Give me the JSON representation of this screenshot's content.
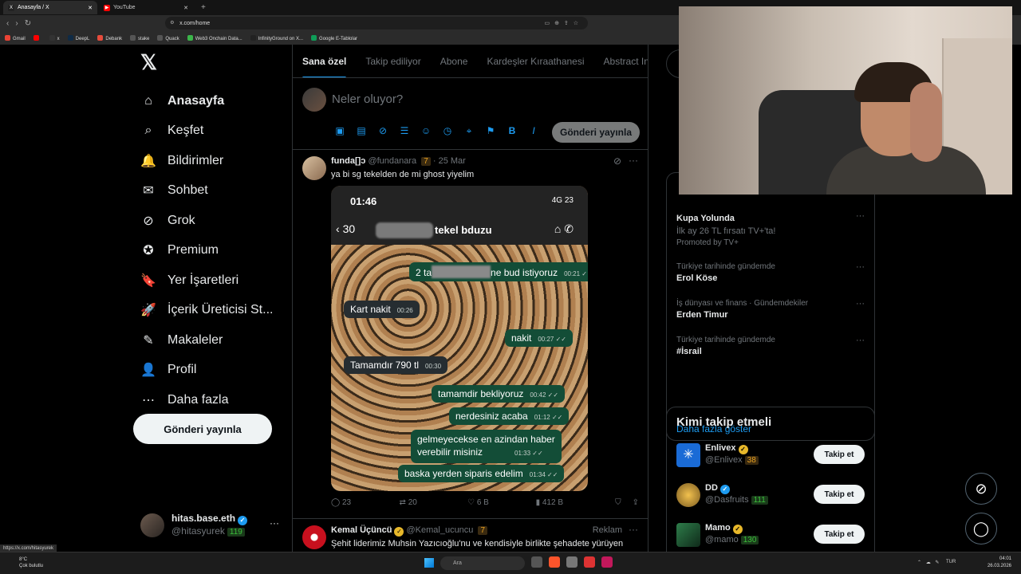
{
  "browser": {
    "tabs": [
      {
        "label": "Anasayfa / X",
        "close": "✕"
      },
      {
        "label": "YouTube",
        "close": "✕"
      }
    ],
    "new_tab": "+",
    "url": "x.com/home",
    "bookmarks": [
      "Gmail",
      "x",
      "DeepL",
      "Debank",
      "stake",
      "Quack",
      "Web3 Onchain Data...",
      "InfinityGround on X...",
      "Google E-Tablolar"
    ],
    "status_url": "https://x.com/hitasyurek"
  },
  "sidebar": {
    "logo": "𝕏",
    "items": [
      {
        "label": "Anasayfa",
        "icon": "home-icon",
        "glyph": "⌂"
      },
      {
        "label": "Keşfet",
        "icon": "search-icon",
        "glyph": "⌕"
      },
      {
        "label": "Bildirimler",
        "icon": "bell-icon",
        "glyph": "🔔"
      },
      {
        "label": "Sohbet",
        "icon": "mail-icon",
        "glyph": "✉"
      },
      {
        "label": "Grok",
        "icon": "grok-icon",
        "glyph": "⊘"
      },
      {
        "label": "Premium",
        "icon": "premium-icon",
        "glyph": "✪"
      },
      {
        "label": "Yer İşaretleri",
        "icon": "bookmark-icon",
        "glyph": "🔖"
      },
      {
        "label": "İçerik Üreticisi St...",
        "icon": "rocket-icon",
        "glyph": "🚀"
      },
      {
        "label": "Makaleler",
        "icon": "article-icon",
        "glyph": "✎"
      },
      {
        "label": "Profil",
        "icon": "profile-icon",
        "glyph": "👤"
      },
      {
        "label": "Daha fazla",
        "icon": "more-icon",
        "glyph": "⋯"
      }
    ],
    "post_button": "Gönderi yayınla",
    "account": {
      "name": "hitas.base.eth",
      "handle": "@hitasyurek",
      "badge": "119",
      "more": "···"
    }
  },
  "feed": {
    "tabs": [
      "Sana özel",
      "Takip ediliyor",
      "Abone",
      "Kardeşler Kıraathanesi",
      "Abstract Int"
    ],
    "composer": {
      "placeholder": "Neler oluyor?",
      "post_button": "Gönderi yayınla"
    },
    "post1": {
      "name": "funda[]ɔ",
      "handle": "@fundanara",
      "badge": "7",
      "date": "· 25 Mar",
      "text": "ya bi sg tekelden de mi ghost yiyelim",
      "screenshot": {
        "time": "01:46",
        "signal": "4G 23",
        "back_count": "30",
        "contact": "tekel bduzu",
        "messages": [
          {
            "dir": "out",
            "text_a": "2 ta",
            "text_b": "ne bud istiyoruz",
            "time": "00:21 ✓✓"
          },
          {
            "dir": "in",
            "text": "Kart nakit",
            "time": "00:26"
          },
          {
            "dir": "out",
            "text": "nakit",
            "time": "00:27 ✓✓"
          },
          {
            "dir": "in",
            "text": "Tamamdır 790 tl",
            "time": "00:30"
          },
          {
            "dir": "out",
            "text": "tamamdir bekliyoruz",
            "time": "00:42 ✓✓"
          },
          {
            "dir": "out",
            "text": "nerdesiniz acaba",
            "time": "01:12 ✓✓"
          },
          {
            "dir": "out",
            "text": "gelmeyecekse en azindan haber",
            "time": ""
          },
          {
            "dir": "out",
            "text": "verebilir misiniz",
            "time": "01:33 ✓✓"
          },
          {
            "dir": "out",
            "text": "baska yerden siparis edelim",
            "time": "01:34 ✓✓"
          }
        ]
      },
      "stats": {
        "replies": "23",
        "reposts": "20",
        "likes": "6 B",
        "views": "412 B"
      }
    },
    "post2": {
      "name": "Kemal Üçüncü",
      "handle": "@Kemal_ucuncu",
      "badge": "7",
      "tag": "Reklam",
      "text": "Şehit liderimiz Muhsin Yazıcıoğlu'nu ve kendisiyle birlikte şehadete yürüyen"
    }
  },
  "right": {
    "trends": [
      {
        "cat": "",
        "title": "Kupa Yolunda",
        "sub": "İlk ay 26 TL fırsatı TV+'ta!",
        "sub2": "Promoted by TV+"
      },
      {
        "cat": "Türkiye tarihinde gündemde",
        "title": "Erol Köse"
      },
      {
        "cat": "İş dünyası ve finans · Gündemdekiler",
        "title": "Erden Timur"
      },
      {
        "cat": "Türkiye tarihinde gündemde",
        "title": "#İsrail"
      }
    ],
    "show_more": "Daha fazla göster",
    "who_to_follow": {
      "title": "Kimi takip etmeli",
      "items": [
        {
          "name": "Enlivex",
          "handle": "@Enlivex",
          "badge": "38",
          "button": "Takip et"
        },
        {
          "name": "DD",
          "handle": "@Dasfruits",
          "badge": "111",
          "button": "Takip et"
        },
        {
          "name": "Mamo",
          "handle": "@mamo",
          "badge": "130",
          "button": "Takip et"
        }
      ]
    }
  },
  "taskbar": {
    "weather_temp": "8°C",
    "weather_desc": "Çok bulutlu",
    "search": "Ara",
    "lang": "TUR",
    "time": "04:01",
    "date": "26.03.2026"
  },
  "colors": {
    "accent": "#1d9bf0",
    "bg": "#000000",
    "border": "#2f3336"
  }
}
